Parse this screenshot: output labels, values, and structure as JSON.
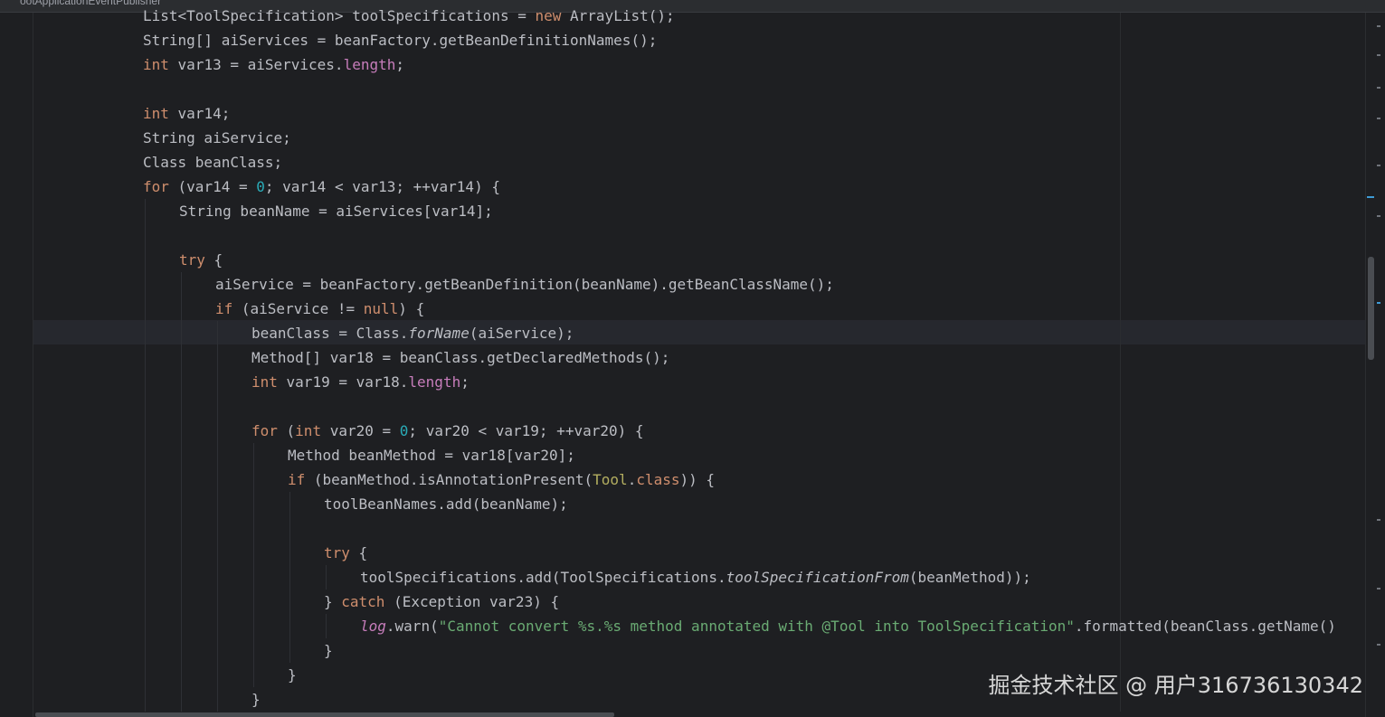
{
  "window": {
    "tab_label": "ootApplicationEventPublisher"
  },
  "editor": {
    "lines": [
      {
        "id": "l1",
        "tokens": [
          {
            "t": "List<ToolSpecification> toolSpecifications = "
          },
          {
            "t": "new",
            "c": "kw"
          },
          {
            "t": " ArrayList();"
          }
        ]
      },
      {
        "id": "l2",
        "tokens": [
          {
            "t": "String[] aiServices = beanFactory.getBeanDefinitionNames();"
          }
        ]
      },
      {
        "id": "l3",
        "tokens": [
          {
            "t": "int",
            "c": "kw"
          },
          {
            "t": " var13 = aiServices."
          },
          {
            "t": "length",
            "c": "fld"
          },
          {
            "t": ";"
          }
        ]
      },
      {
        "id": "l4",
        "tokens": []
      },
      {
        "id": "l5",
        "tokens": [
          {
            "t": "int",
            "c": "kw"
          },
          {
            "t": " var14;"
          }
        ]
      },
      {
        "id": "l6",
        "tokens": [
          {
            "t": "String aiService;"
          }
        ]
      },
      {
        "id": "l7",
        "tokens": [
          {
            "t": "Class beanClass;"
          }
        ]
      },
      {
        "id": "l8",
        "tokens": [
          {
            "t": "for",
            "c": "kw"
          },
          {
            "t": " (var14 = "
          },
          {
            "t": "0",
            "c": "num"
          },
          {
            "t": "; var14 < var13; ++var14) {"
          }
        ]
      },
      {
        "id": "l9",
        "tokens": [
          {
            "t": "String beanName = aiServices[var14];"
          }
        ]
      },
      {
        "id": "l10",
        "tokens": []
      },
      {
        "id": "l11",
        "tokens": [
          {
            "t": "try",
            "c": "kw"
          },
          {
            "t": " {"
          }
        ]
      },
      {
        "id": "l12",
        "tokens": [
          {
            "t": "aiService = beanFactory.getBeanDefinition(beanName).getBeanClassName();"
          }
        ]
      },
      {
        "id": "l13",
        "tokens": [
          {
            "t": "if",
            "c": "kw"
          },
          {
            "t": " (aiService != "
          },
          {
            "t": "null",
            "c": "kw"
          },
          {
            "t": ") {"
          }
        ]
      },
      {
        "id": "l14",
        "tokens": [
          {
            "t": "beanClass = Class."
          },
          {
            "t": "forName",
            "c": "it"
          },
          {
            "t": "(aiService);"
          }
        ]
      },
      {
        "id": "l15",
        "tokens": [
          {
            "t": "Method[] var18 = beanClass.getDeclaredMethods();"
          }
        ]
      },
      {
        "id": "l16",
        "tokens": [
          {
            "t": "int",
            "c": "kw"
          },
          {
            "t": " var19 = var18."
          },
          {
            "t": "length",
            "c": "fld"
          },
          {
            "t": ";"
          }
        ]
      },
      {
        "id": "l17",
        "tokens": []
      },
      {
        "id": "l18",
        "tokens": [
          {
            "t": "for",
            "c": "kw"
          },
          {
            "t": " ("
          },
          {
            "t": "int",
            "c": "kw"
          },
          {
            "t": " var20 = "
          },
          {
            "t": "0",
            "c": "num"
          },
          {
            "t": "; var20 < var19; ++var20) {"
          }
        ]
      },
      {
        "id": "l19",
        "tokens": [
          {
            "t": "Method beanMethod = var18[var20];"
          }
        ]
      },
      {
        "id": "l20",
        "tokens": [
          {
            "t": "if",
            "c": "kw"
          },
          {
            "t": " (beanMethod.isAnnotationPresent("
          },
          {
            "t": "Tool",
            "c": "ann"
          },
          {
            "t": "."
          },
          {
            "t": "class",
            "c": "kw"
          },
          {
            "t": ")) {"
          }
        ]
      },
      {
        "id": "l21",
        "tokens": [
          {
            "t": "toolBeanNames.add(beanName);"
          }
        ]
      },
      {
        "id": "l22",
        "tokens": []
      },
      {
        "id": "l23",
        "tokens": [
          {
            "t": "try",
            "c": "kw"
          },
          {
            "t": " {"
          }
        ]
      },
      {
        "id": "l24",
        "tokens": [
          {
            "t": "toolSpecifications.add(ToolSpecifications."
          },
          {
            "t": "toolSpecificationFrom",
            "c": "it"
          },
          {
            "t": "(beanMethod));"
          }
        ]
      },
      {
        "id": "l25",
        "tokens": [
          {
            "t": "} "
          },
          {
            "t": "catch",
            "c": "kw"
          },
          {
            "t": " (Exception var23) {"
          }
        ]
      },
      {
        "id": "l26",
        "tokens": [
          {
            "t": "log",
            "c": "fld it"
          },
          {
            "t": ".warn("
          },
          {
            "t": "\"Cannot convert %s.%s method annotated with @Tool into ToolSpecification\"",
            "c": "str"
          },
          {
            "t": ".formatted(beanClass.getName()"
          }
        ]
      },
      {
        "id": "l27",
        "tokens": [
          {
            "t": "}"
          }
        ]
      },
      {
        "id": "l28",
        "tokens": [
          {
            "t": "}"
          }
        ]
      },
      {
        "id": "l29",
        "tokens": [
          {
            "t": "}"
          }
        ]
      }
    ]
  },
  "watermark": {
    "text": "掘金技术社区 @ 用户316736130342"
  }
}
